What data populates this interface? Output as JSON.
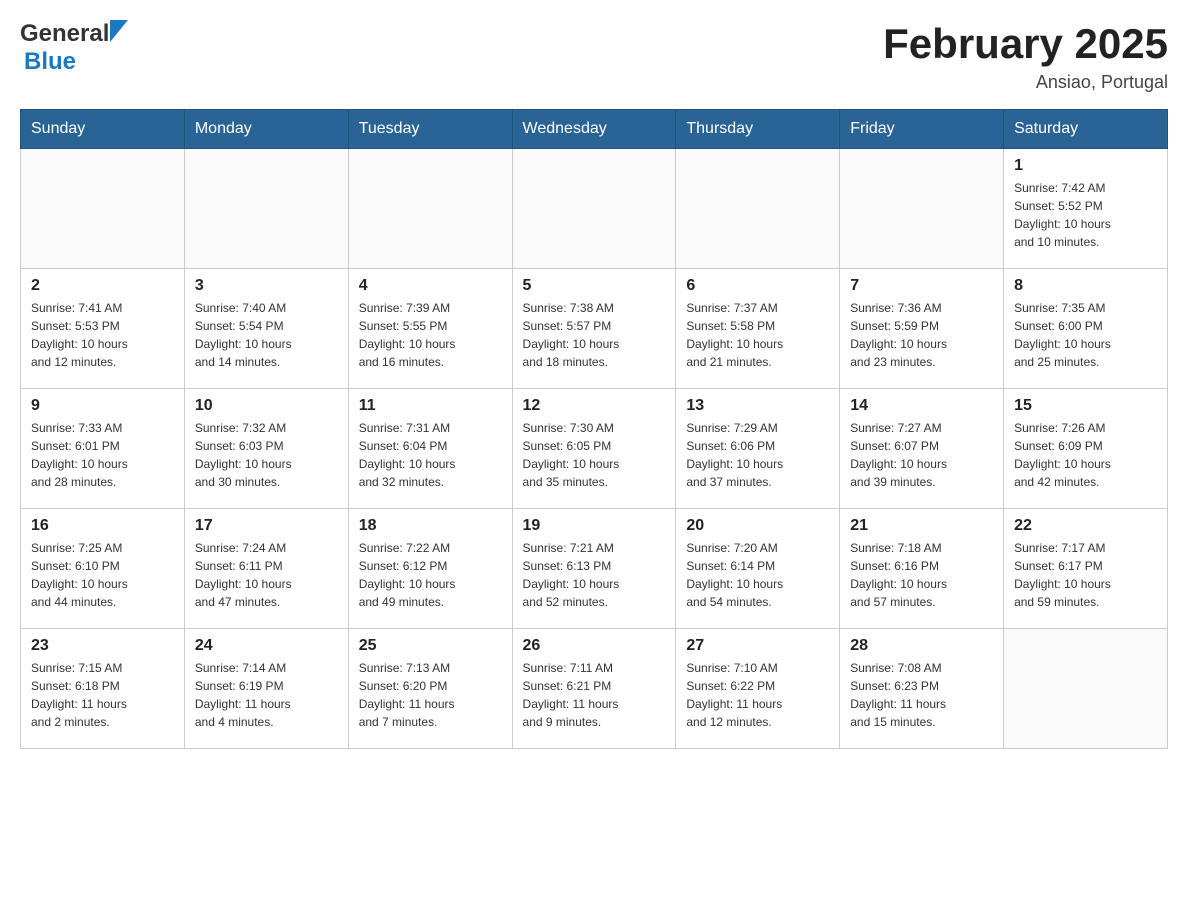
{
  "header": {
    "logo_general": "General",
    "logo_blue": "Blue",
    "month_title": "February 2025",
    "location": "Ansiao, Portugal"
  },
  "days_of_week": [
    "Sunday",
    "Monday",
    "Tuesday",
    "Wednesday",
    "Thursday",
    "Friday",
    "Saturday"
  ],
  "weeks": [
    [
      {
        "day": "",
        "info": ""
      },
      {
        "day": "",
        "info": ""
      },
      {
        "day": "",
        "info": ""
      },
      {
        "day": "",
        "info": ""
      },
      {
        "day": "",
        "info": ""
      },
      {
        "day": "",
        "info": ""
      },
      {
        "day": "1",
        "info": "Sunrise: 7:42 AM\nSunset: 5:52 PM\nDaylight: 10 hours\nand 10 minutes."
      }
    ],
    [
      {
        "day": "2",
        "info": "Sunrise: 7:41 AM\nSunset: 5:53 PM\nDaylight: 10 hours\nand 12 minutes."
      },
      {
        "day": "3",
        "info": "Sunrise: 7:40 AM\nSunset: 5:54 PM\nDaylight: 10 hours\nand 14 minutes."
      },
      {
        "day": "4",
        "info": "Sunrise: 7:39 AM\nSunset: 5:55 PM\nDaylight: 10 hours\nand 16 minutes."
      },
      {
        "day": "5",
        "info": "Sunrise: 7:38 AM\nSunset: 5:57 PM\nDaylight: 10 hours\nand 18 minutes."
      },
      {
        "day": "6",
        "info": "Sunrise: 7:37 AM\nSunset: 5:58 PM\nDaylight: 10 hours\nand 21 minutes."
      },
      {
        "day": "7",
        "info": "Sunrise: 7:36 AM\nSunset: 5:59 PM\nDaylight: 10 hours\nand 23 minutes."
      },
      {
        "day": "8",
        "info": "Sunrise: 7:35 AM\nSunset: 6:00 PM\nDaylight: 10 hours\nand 25 minutes."
      }
    ],
    [
      {
        "day": "9",
        "info": "Sunrise: 7:33 AM\nSunset: 6:01 PM\nDaylight: 10 hours\nand 28 minutes."
      },
      {
        "day": "10",
        "info": "Sunrise: 7:32 AM\nSunset: 6:03 PM\nDaylight: 10 hours\nand 30 minutes."
      },
      {
        "day": "11",
        "info": "Sunrise: 7:31 AM\nSunset: 6:04 PM\nDaylight: 10 hours\nand 32 minutes."
      },
      {
        "day": "12",
        "info": "Sunrise: 7:30 AM\nSunset: 6:05 PM\nDaylight: 10 hours\nand 35 minutes."
      },
      {
        "day": "13",
        "info": "Sunrise: 7:29 AM\nSunset: 6:06 PM\nDaylight: 10 hours\nand 37 minutes."
      },
      {
        "day": "14",
        "info": "Sunrise: 7:27 AM\nSunset: 6:07 PM\nDaylight: 10 hours\nand 39 minutes."
      },
      {
        "day": "15",
        "info": "Sunrise: 7:26 AM\nSunset: 6:09 PM\nDaylight: 10 hours\nand 42 minutes."
      }
    ],
    [
      {
        "day": "16",
        "info": "Sunrise: 7:25 AM\nSunset: 6:10 PM\nDaylight: 10 hours\nand 44 minutes."
      },
      {
        "day": "17",
        "info": "Sunrise: 7:24 AM\nSunset: 6:11 PM\nDaylight: 10 hours\nand 47 minutes."
      },
      {
        "day": "18",
        "info": "Sunrise: 7:22 AM\nSunset: 6:12 PM\nDaylight: 10 hours\nand 49 minutes."
      },
      {
        "day": "19",
        "info": "Sunrise: 7:21 AM\nSunset: 6:13 PM\nDaylight: 10 hours\nand 52 minutes."
      },
      {
        "day": "20",
        "info": "Sunrise: 7:20 AM\nSunset: 6:14 PM\nDaylight: 10 hours\nand 54 minutes."
      },
      {
        "day": "21",
        "info": "Sunrise: 7:18 AM\nSunset: 6:16 PM\nDaylight: 10 hours\nand 57 minutes."
      },
      {
        "day": "22",
        "info": "Sunrise: 7:17 AM\nSunset: 6:17 PM\nDaylight: 10 hours\nand 59 minutes."
      }
    ],
    [
      {
        "day": "23",
        "info": "Sunrise: 7:15 AM\nSunset: 6:18 PM\nDaylight: 11 hours\nand 2 minutes."
      },
      {
        "day": "24",
        "info": "Sunrise: 7:14 AM\nSunset: 6:19 PM\nDaylight: 11 hours\nand 4 minutes."
      },
      {
        "day": "25",
        "info": "Sunrise: 7:13 AM\nSunset: 6:20 PM\nDaylight: 11 hours\nand 7 minutes."
      },
      {
        "day": "26",
        "info": "Sunrise: 7:11 AM\nSunset: 6:21 PM\nDaylight: 11 hours\nand 9 minutes."
      },
      {
        "day": "27",
        "info": "Sunrise: 7:10 AM\nSunset: 6:22 PM\nDaylight: 11 hours\nand 12 minutes."
      },
      {
        "day": "28",
        "info": "Sunrise: 7:08 AM\nSunset: 6:23 PM\nDaylight: 11 hours\nand 15 minutes."
      },
      {
        "day": "",
        "info": ""
      }
    ]
  ]
}
